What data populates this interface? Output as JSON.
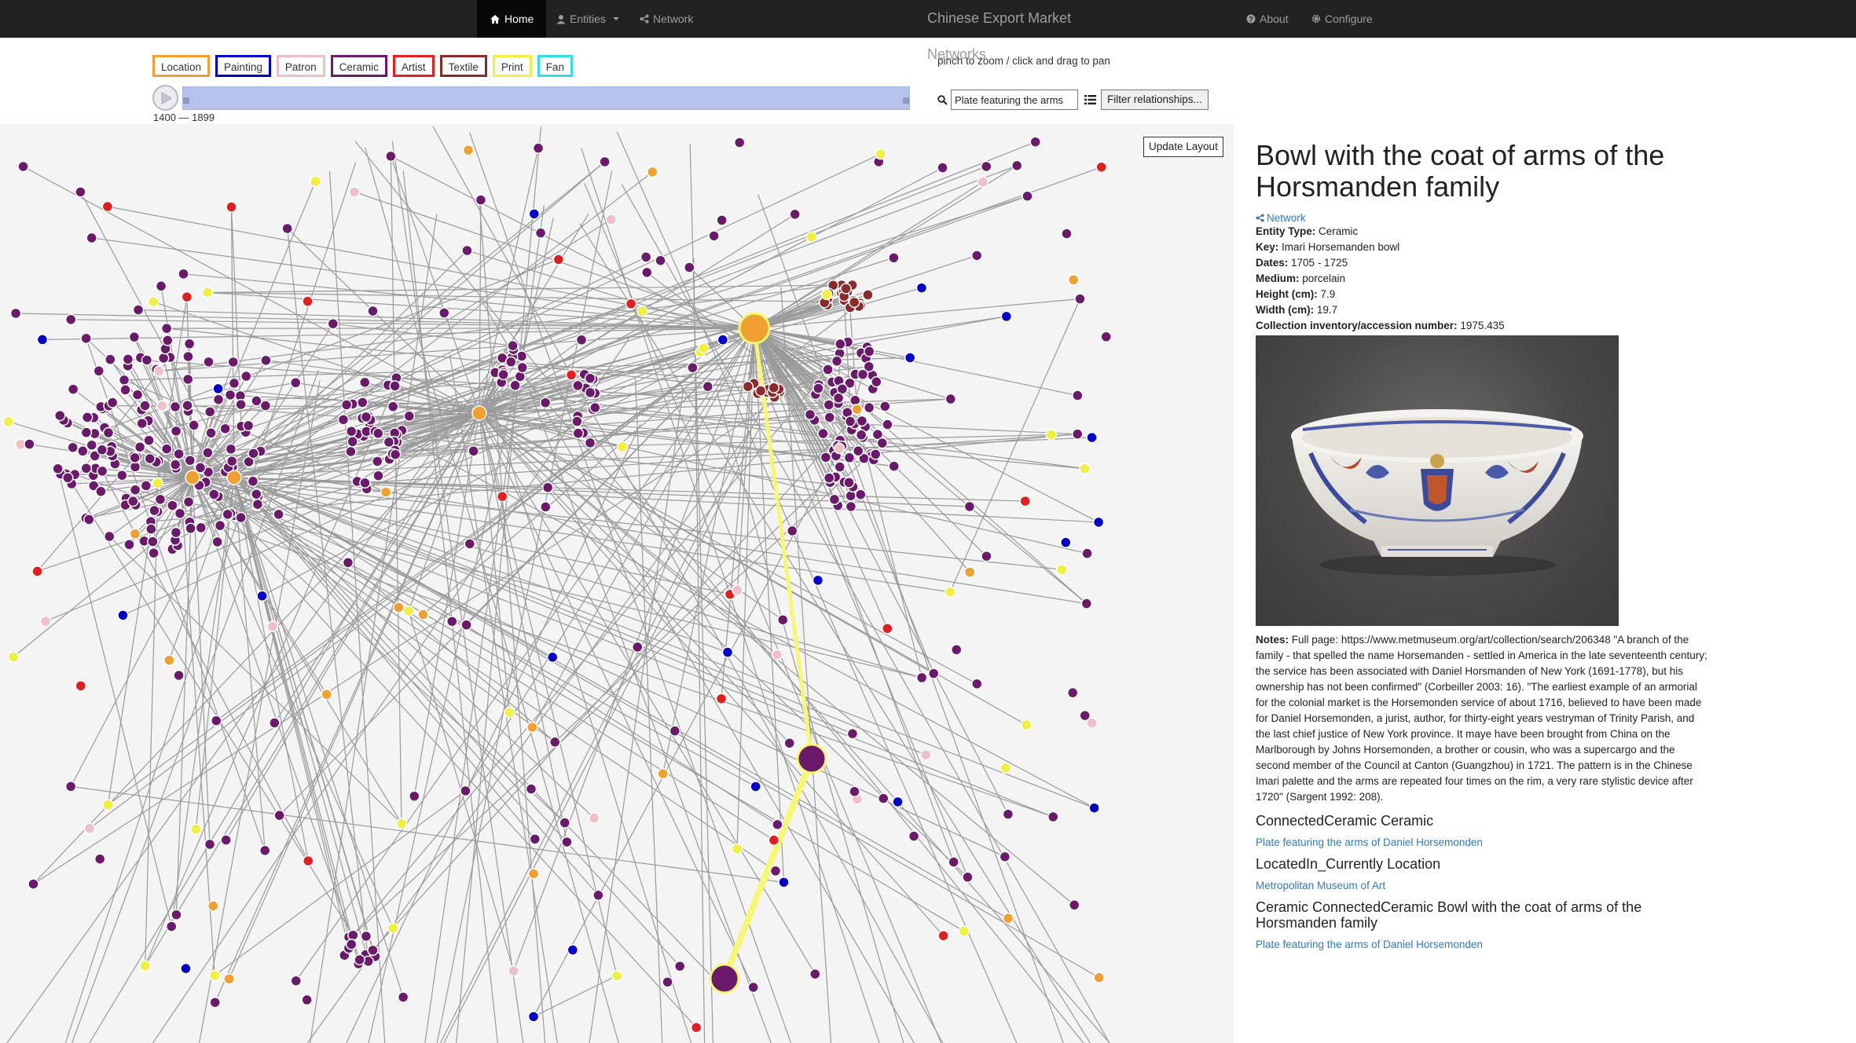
{
  "nav": {
    "home": "Home",
    "entities": "Entities",
    "network": "Network",
    "title": "Chinese Export Market Networks",
    "about": "About",
    "configure": "Configure"
  },
  "legend": [
    {
      "label": "Location",
      "color": "#f0a030"
    },
    {
      "label": "Painting",
      "color": "#0000cc"
    },
    {
      "label": "Patron",
      "color": "#f0c0c8"
    },
    {
      "label": "Ceramic",
      "color": "#6b1a6b"
    },
    {
      "label": "Artist",
      "color": "#e02020"
    },
    {
      "label": "Textile",
      "color": "#8b2a2a"
    },
    {
      "label": "Print",
      "color": "#f0f040"
    },
    {
      "label": "Fan",
      "color": "#30e0e0"
    }
  ],
  "timeline": {
    "range": "1400 — 1899"
  },
  "hint": "pinch to zoom / click and drag to pan",
  "search": {
    "value": "Plate featuring the arms"
  },
  "filter_button": "Filter relationships...",
  "update_button": "Update Layout",
  "detail": {
    "title": "Bowl with the coat of arms of the Horsmanden family",
    "network_link": "Network",
    "fields": [
      {
        "label": "Entity Type:",
        "value": "Ceramic"
      },
      {
        "label": "Key:",
        "value": "Imari Horsemanden bowl"
      },
      {
        "label": "Dates:",
        "value": "1705 - 1725"
      },
      {
        "label": "Medium:",
        "value": "porcelain"
      },
      {
        "label": "Height (cm):",
        "value": "7.9"
      },
      {
        "label": "Width (cm):",
        "value": "19.7"
      },
      {
        "label": "Collection inventory/accession number:",
        "value": "1975.435"
      }
    ],
    "notes_label": "Notes:",
    "notes_text": "Full page: https://www.metmuseum.org/art/collection/search/206348 \"A branch of the family - that spelled the name Horsemanden - settled in America in the late seventeenth century; the service has been associated with Daniel Horsmanden of New York (1691-1778), but his ownership has not been confirmed\" (Corbeiller 2003: 16). \"The earliest example of an armorial for the colonial market is the Horsemonden service of about 1716, believed to have been made for Daniel Horsemonden, a jurist, author, for thirty-eight years vestryman of Trinity Parish, and the last chief justice of New York province. It maye have been brought from China on the Marlborough by Johns Horsemonden, a brother or cousin, who was a supercargo and the second member of the Council at Canton (Guangzhou) in 1721. The pattern is in the Chinese Imari palette and the arms are repeated four times on the rim, a very rare stylistic device after 1720\" (Sargent 1992: 208).",
    "sections": [
      {
        "heading": "ConnectedCeramic Ceramic",
        "link": "Plate featuring the arms of Daniel Horsemonden"
      },
      {
        "heading": "LocatedIn_Currently Location",
        "link": "Metropolitan Museum of Art"
      },
      {
        "heading": "Ceramic ConnectedCeramic Bowl with the coat of arms of the Horsmanden family",
        "link": "Plate featuring the arms of Daniel Horsemonden"
      }
    ]
  }
}
